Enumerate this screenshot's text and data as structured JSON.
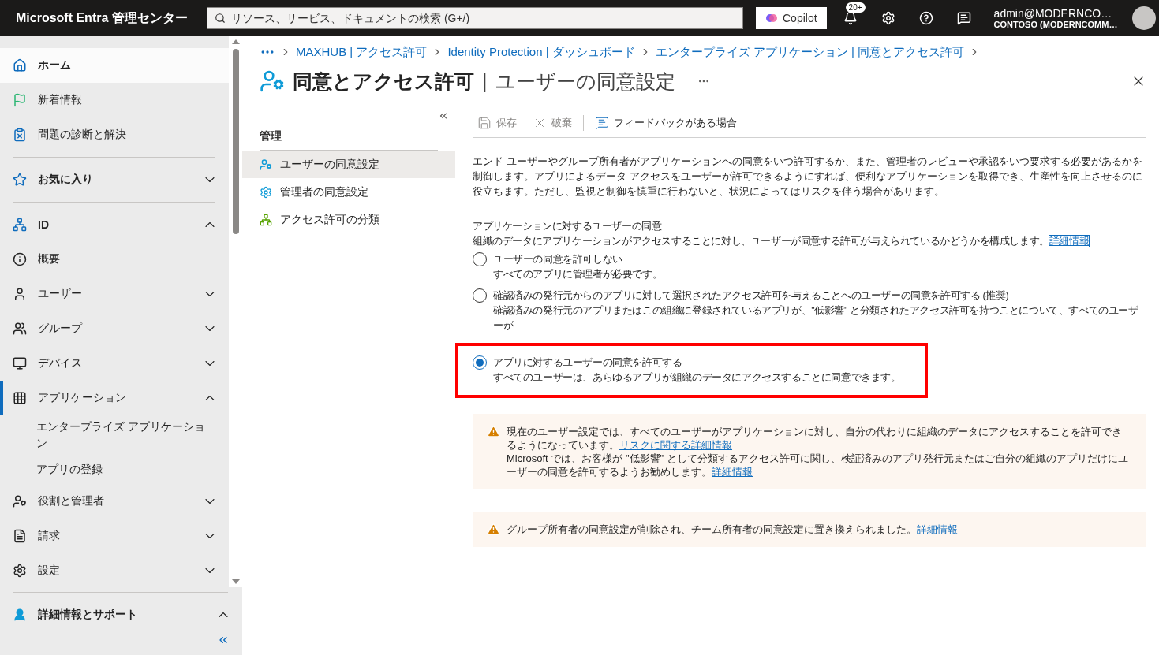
{
  "topbar": {
    "brand": "Microsoft Entra 管理センター",
    "search": {
      "placeholder": "リソース、サービス、ドキュメントの検索 (G+/)"
    },
    "copilot": "Copilot",
    "notification_badge": "20+",
    "account": {
      "name": "admin@MODERNCO…",
      "tenant": "CONTOSO (MODERNCOMM…"
    }
  },
  "sidebar": {
    "items": [
      {
        "kind": "link",
        "label": "ホーム",
        "selected": true
      },
      {
        "kind": "link",
        "label": "新着情報",
        "selected": false
      },
      {
        "kind": "link",
        "label": "問題の診断と解決",
        "selected": false
      },
      {
        "kind": "section",
        "label": "お気に入り",
        "expanded": false
      },
      {
        "kind": "section",
        "label": "ID",
        "expanded": true
      },
      {
        "kind": "link",
        "label": "概要",
        "selected": false
      },
      {
        "kind": "group",
        "label": "ユーザー",
        "selected": false,
        "expanded": false
      },
      {
        "kind": "group",
        "label": "グループ",
        "selected": false,
        "expanded": false
      },
      {
        "kind": "group",
        "label": "デバイス",
        "selected": false,
        "expanded": false
      },
      {
        "kind": "group",
        "label": "アプリケーション",
        "selected": false,
        "expanded": true,
        "active": true,
        "children": [
          {
            "label": "エンタープライズ アプリケーション"
          },
          {
            "label": "アプリの登録"
          }
        ]
      },
      {
        "kind": "group",
        "label": "役割と管理者",
        "selected": false,
        "expanded": false
      },
      {
        "kind": "group",
        "label": "請求",
        "selected": false,
        "expanded": false
      },
      {
        "kind": "group",
        "label": "設定",
        "selected": false,
        "expanded": false
      }
    ],
    "footer": {
      "label": "詳細情報とサポート",
      "expanded": true
    }
  },
  "breadcrumb": [
    "MAXHUB | アクセス許可",
    "Identity Protection | ダッシュボード",
    "エンタープライズ アプリケーション | 同意とアクセス許可"
  ],
  "page": {
    "title": "同意とアクセス許可",
    "separator": "|",
    "subtitle": "ユーザーの同意設定"
  },
  "submenu": {
    "heading": "管理",
    "items": [
      {
        "label": "ユーザーの同意設定",
        "selected": true
      },
      {
        "label": "管理者の同意設定",
        "selected": false
      },
      {
        "label": "アクセス許可の分類",
        "selected": false
      }
    ]
  },
  "toolbar": [
    {
      "label": "保存",
      "disabled": true
    },
    {
      "label": "破棄",
      "disabled": true
    },
    {
      "label": "フィードバックがある場合",
      "disabled": false
    }
  ],
  "intro": "エンド ユーザーやグループ所有者がアプリケーションへの同意をいつ許可するか、また、管理者のレビューや承認をいつ要求する必要があるかを制御します。アプリによるデータ アクセスをユーザーが許可できるようにすれば、便利なアプリケーションを取得でき、生産性を向上させるのに役立ちます。ただし、監視と制御を慎重に行わないと、状況によってはリスクを伴う場合があります。",
  "consent": {
    "heading": "アプリケーションに対するユーザーの同意",
    "description": "組織のデータにアプリケーションがアクセスすることに対し、ユーザーが同意する許可が与えられているかどうかを構成します。",
    "link": "詳細情報",
    "options": [
      {
        "label": "ユーザーの同意を許可しない",
        "description": "すべてのアプリに管理者が必要です。",
        "selected": false,
        "highlighted": false
      },
      {
        "label": "確認済みの発行元からのアプリに対して選択されたアクセス許可を与えることへのユーザーの同意を許可する (推奨)",
        "description": "確認済みの発行元のアプリまたはこの組織に登録されているアプリが、\"低影響\" と分類されたアクセス許可を持つことについて、すべてのユーザーが",
        "selected": false,
        "highlighted": false
      },
      {
        "label": "アプリに対するユーザーの同意を許可する",
        "description": "すべてのユーザーは、あらゆるアプリが組織のデータにアクセスすることに同意できます。",
        "selected": true,
        "highlighted": true
      }
    ]
  },
  "alerts": [
    {
      "lines": [
        {
          "text": "現在のユーザー設定では、すべてのユーザーがアプリケーションに対し、自分の代わりに組織のデータにアクセスすることを許可できるようになっています。",
          "link": "リスクに関する詳細情報"
        },
        {
          "text": "Microsoft では、お客様が \"低影響\" として分類するアクセス許可に関し、検証済みのアプリ発行元またはご自分の組織のアプリだけにユーザーの同意を許可するようお勧めします。",
          "link": "詳細情報"
        }
      ]
    },
    {
      "lines": [
        {
          "text": "グループ所有者の同意設定が削除され、チーム所有者の同意設定に置き換えられました。",
          "link": "詳細情報"
        }
      ]
    }
  ]
}
